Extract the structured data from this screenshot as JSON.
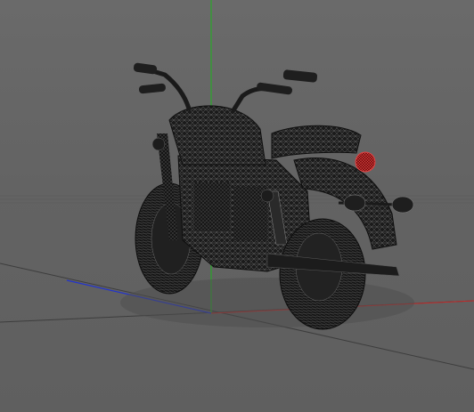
{
  "viewport": {
    "background": "#646464",
    "grid_color": "#3a3a3a",
    "axis_colors": {
      "x": "#c62828",
      "y": "#1db31d",
      "z": "#2233cc"
    },
    "model": {
      "name": "motorcycle",
      "display_mode": "wireframe-shaded",
      "body_color": "#1b1b1b",
      "wire_color": "#9a9a9a",
      "selected_part": "tail-light",
      "selection_color": "#d23030"
    }
  }
}
